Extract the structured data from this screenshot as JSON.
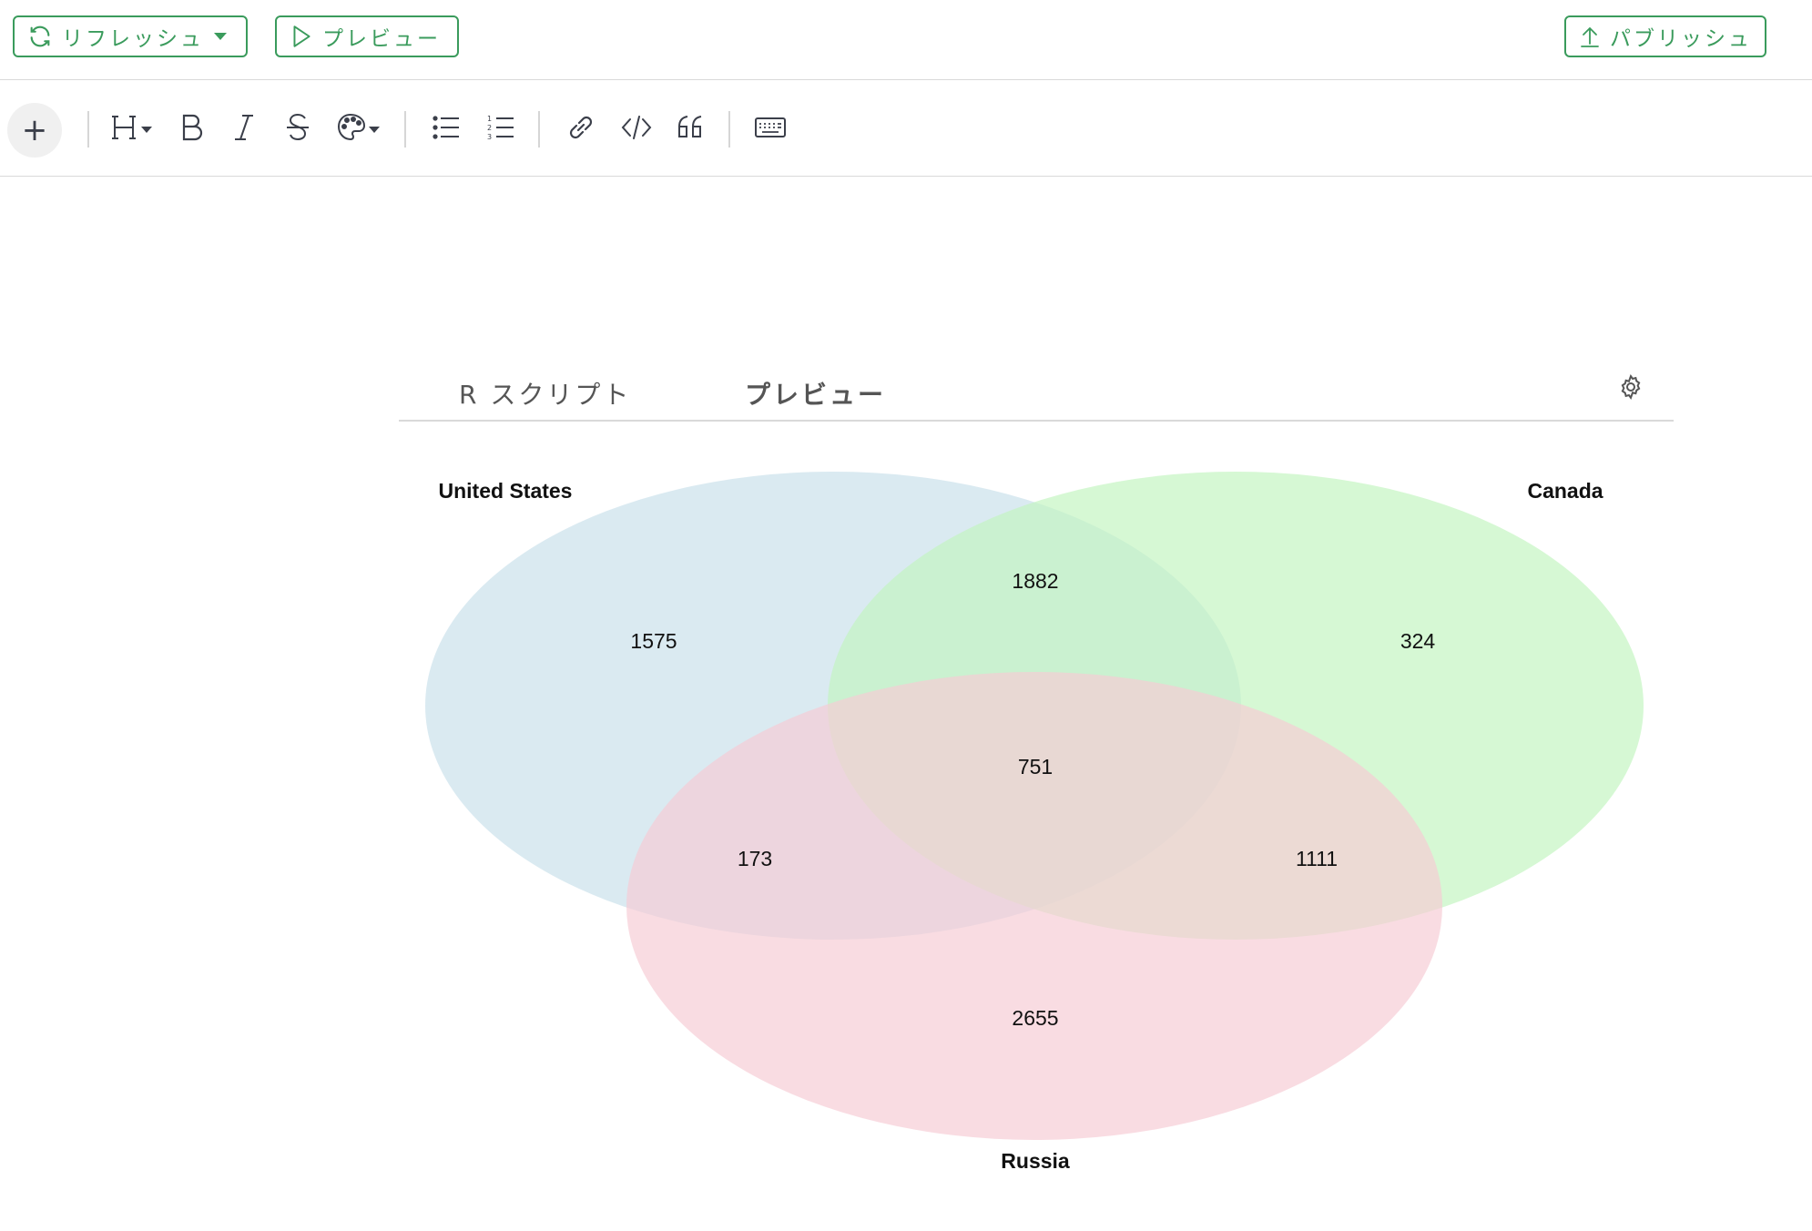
{
  "topbar": {
    "refresh_label": "リフレッシュ",
    "preview_label": "プレビュー",
    "publish_label": "パブリッシュ"
  },
  "toolbar": {
    "add_label": "+",
    "items": [
      "heading-icon",
      "bold-icon",
      "italic-icon",
      "strikethrough-icon",
      "palette-icon",
      "bullet-list-icon",
      "numbered-list-icon",
      "link-icon",
      "code-icon",
      "quote-icon",
      "keyboard-icon"
    ]
  },
  "tabs": {
    "rscript": "R スクリプト",
    "preview": "プレビュー"
  },
  "colors": {
    "accent": "#3a9b5c",
    "set_united_states": "#c9e0ea",
    "set_canada": "#c2f5bf",
    "set_russia": "#f6ccd4"
  },
  "chart_data": {
    "type": "venn",
    "sets": [
      "United States",
      "Canada",
      "Russia"
    ],
    "regions": {
      "United States only": 1575,
      "Canada only": 324,
      "Russia only": 2655,
      "United States & Canada": 1882,
      "United States & Russia": 173,
      "Canada & Russia": 1111,
      "United States & Canada & Russia": 751
    }
  }
}
